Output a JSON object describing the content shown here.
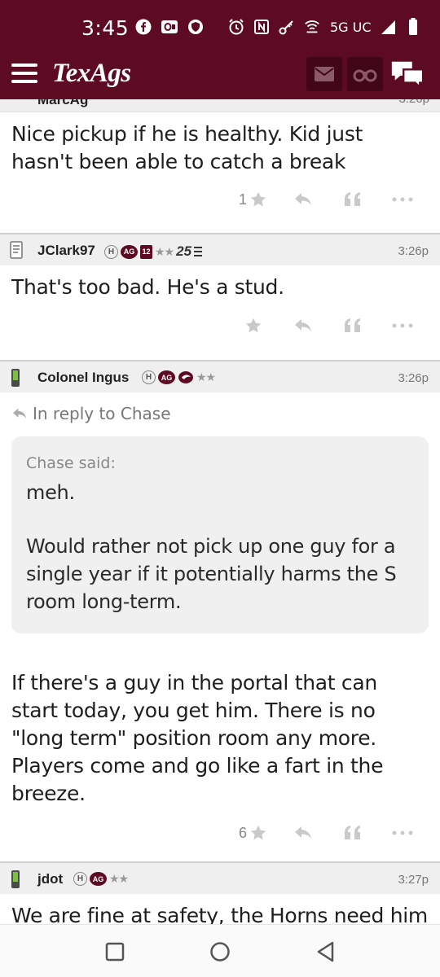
{
  "status_bar": {
    "time": "3:45",
    "network": "5G UC",
    "icons_left": [
      "facebook-icon",
      "outlook-icon",
      "shield-app-icon"
    ],
    "icons_right": [
      "alarm-icon",
      "nfc-icon",
      "key-icon",
      "wifi-calling-icon"
    ]
  },
  "header": {
    "logo": "TexAgs",
    "buttons": [
      "mail-icon",
      "binoculars-icon",
      "chat-icon"
    ]
  },
  "posts": [
    {
      "username": "MarcAg",
      "cutoff": true,
      "body": "Nice pickup if he is healthy. Kid just hasn't been able to catch a break",
      "likes": "1"
    },
    {
      "username": "JClark97",
      "timestamp": "3:26p",
      "badge_25": "25",
      "badge_12": "12",
      "body": "That's too bad. He's a stud.",
      "likes": ""
    },
    {
      "username": "Colonel Ingus",
      "timestamp": "3:26p",
      "reply_to": "In reply to Chase",
      "quote_author": "Chase said:",
      "quote_paragraphs": [
        "meh.",
        "Would rather not pick up one guy for a single year if it potentially harms the S room long-term."
      ],
      "body": "If there's a guy in the portal that can start today, you get him. There is no \"long term\" position room any more. Players come and go like a fart in the breeze.",
      "likes": "6"
    },
    {
      "username": "jdot",
      "timestamp": "3:27p",
      "body": "We are fine at safety, the Horns need him more. I'm more concerned with the lack of CB and LB transfers."
    }
  ],
  "badges": {
    "h": "H",
    "ag": "AG",
    "stars": "★★"
  },
  "colors": {
    "brand_maroon": "#5c0b22",
    "header_button": "#420717",
    "meta_gray": "#777777"
  }
}
